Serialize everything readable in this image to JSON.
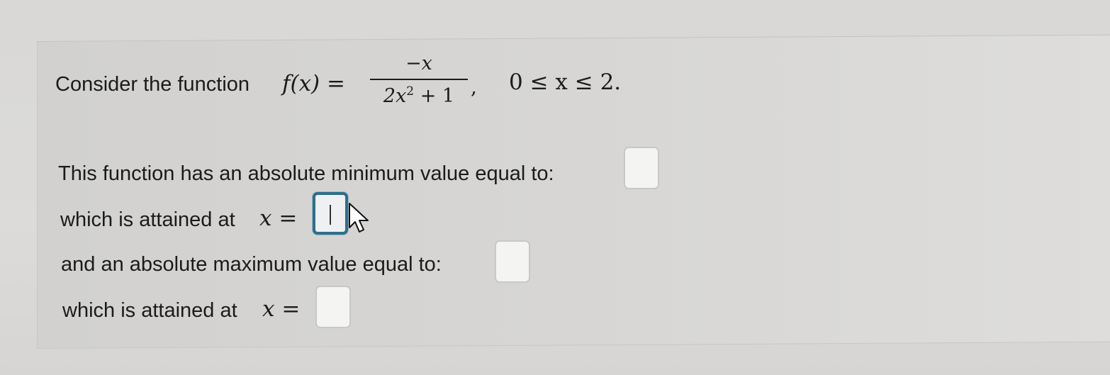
{
  "question": {
    "intro": "Consider the function",
    "function_lhs": "f(x) =",
    "numerator": "−x",
    "denominator_base": "2x",
    "denominator_exp": "2",
    "denominator_rest": " + 1",
    "comma": ",",
    "domain": "0 ≤ x ≤ 2."
  },
  "prompts": {
    "min_value": "This function has an absolute minimum value equal to:",
    "min_at_text": "which is attained at",
    "max_value": "and an absolute maximum value equal to:",
    "max_at_text": "which is attained at",
    "x_equals": "x ="
  },
  "answers": {
    "min_value": "",
    "min_at": "",
    "max_value": "",
    "max_at": ""
  },
  "colors": {
    "focus_border": "#2f6e8a",
    "text": "#1b1b1b"
  }
}
